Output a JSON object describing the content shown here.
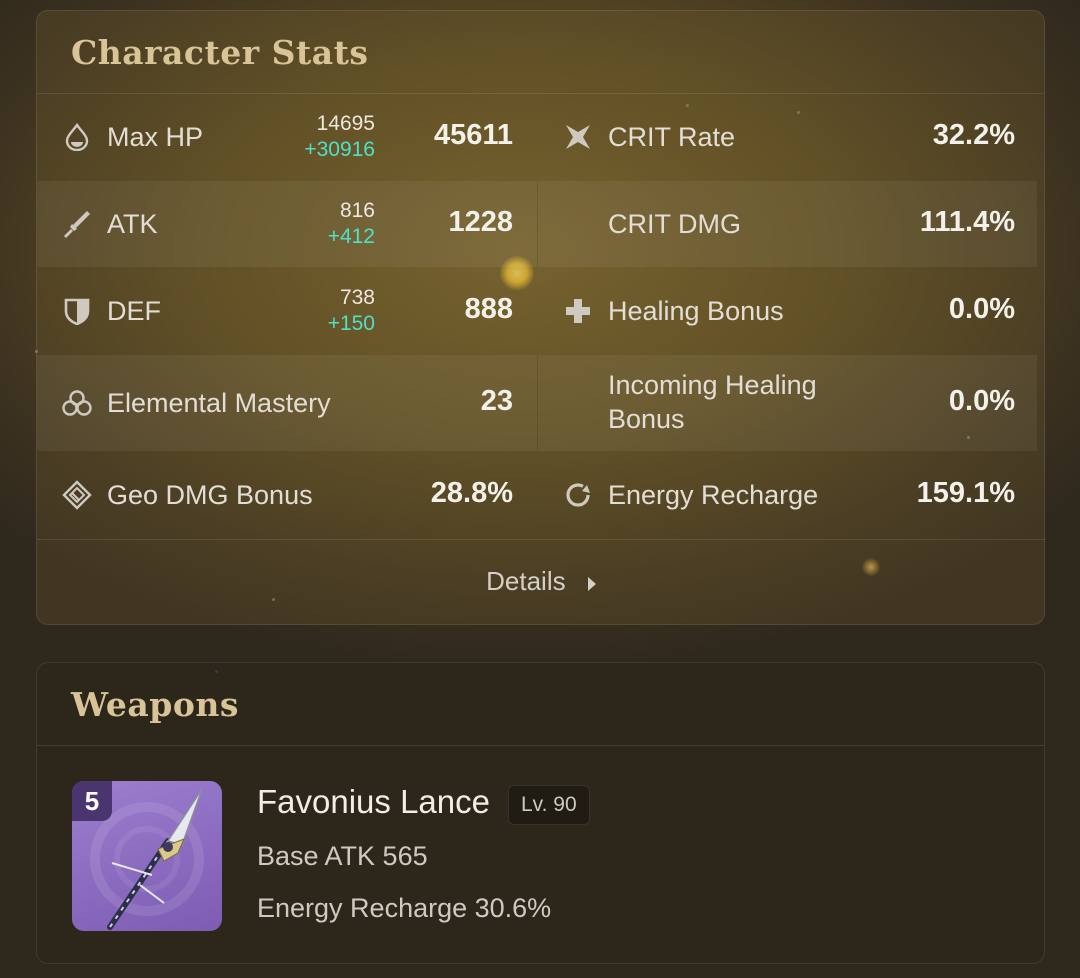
{
  "stats": {
    "title": "Character Stats",
    "left": [
      {
        "name": "Max HP",
        "icon": "droplet-icon",
        "base": "14695",
        "add": "+30916",
        "value": "45611"
      },
      {
        "name": "ATK",
        "icon": "sword-icon",
        "base": "816",
        "add": "+412",
        "value": "1228"
      },
      {
        "name": "DEF",
        "icon": "shield-icon",
        "base": "738",
        "add": "+150",
        "value": "888"
      },
      {
        "name": "Elemental Mastery",
        "icon": "elemental-mastery-icon",
        "value": "23"
      },
      {
        "name": "Geo DMG Bonus",
        "icon": "geo-icon",
        "value": "28.8%"
      }
    ],
    "right": [
      {
        "name": "CRIT Rate",
        "icon": "crit-icon",
        "value": "32.2%"
      },
      {
        "name": "CRIT DMG",
        "icon": "",
        "value": "111.4%"
      },
      {
        "name": "Healing Bonus",
        "icon": "plus-icon",
        "value": "0.0%"
      },
      {
        "name": "Incoming Healing Bonus",
        "icon": "",
        "value": "0.0%"
      },
      {
        "name": "Energy Recharge",
        "icon": "energy-recharge-icon",
        "value": "159.1%"
      }
    ],
    "details_label": "Details"
  },
  "weapons": {
    "title": "Weapons",
    "item": {
      "name": "Favonius Lance",
      "rarity": "5",
      "level": "Lv. 90",
      "base_stat": "Base ATK 565",
      "sub_stat": "Energy Recharge 30.6%"
    }
  },
  "colors": {
    "accent_title": "#d8c496",
    "stat_bonus": "#4fe0c8",
    "weapon_card": "#9d7fcf"
  }
}
